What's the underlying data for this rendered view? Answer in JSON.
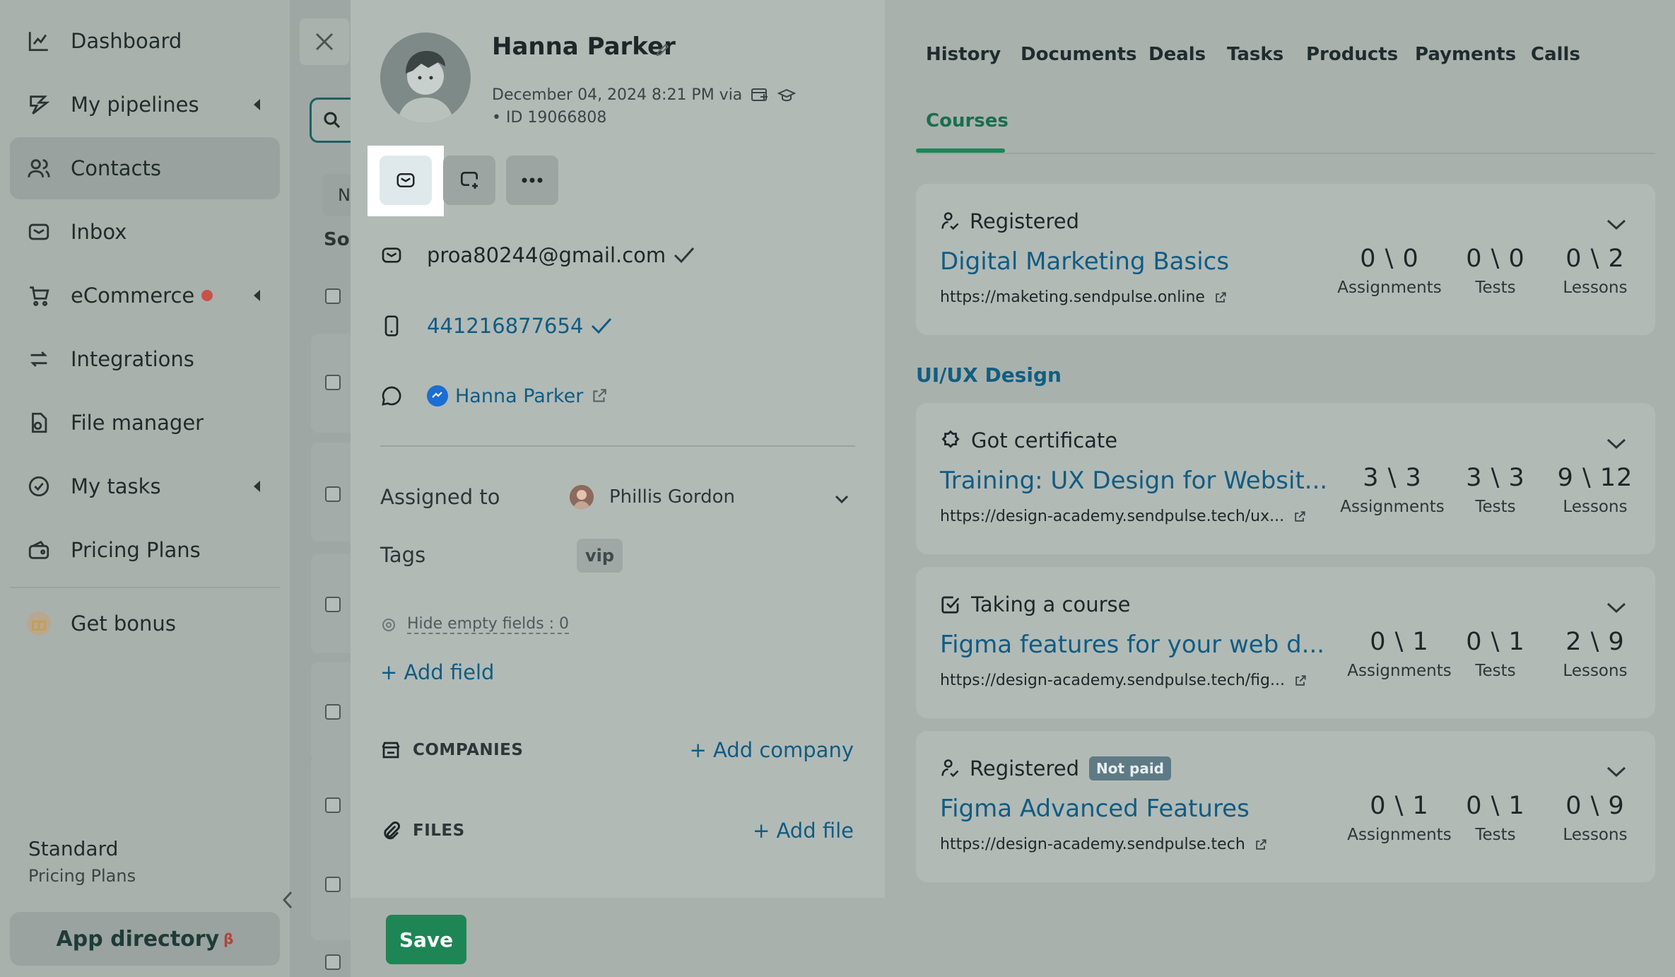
{
  "sidebar": {
    "items": [
      {
        "label": "Dashboard",
        "icon": "chart-line-icon"
      },
      {
        "label": "My pipelines",
        "icon": "pipelines-icon"
      },
      {
        "label": "Contacts",
        "icon": "contacts-icon"
      },
      {
        "label": "Inbox",
        "icon": "inbox-icon"
      },
      {
        "label": "eCommerce",
        "icon": "cart-icon"
      },
      {
        "label": "Integrations",
        "icon": "integrations-icon"
      },
      {
        "label": "File manager",
        "icon": "file-manager-icon"
      },
      {
        "label": "My tasks",
        "icon": "tasks-icon"
      },
      {
        "label": "Pricing Plans",
        "icon": "wallet-icon"
      },
      {
        "label": "Get bonus",
        "icon": "gift-icon"
      }
    ],
    "plan_name": "Standard",
    "plan_sub": "Pricing Plans",
    "app_directory": "App directory",
    "app_directory_badge": "β"
  },
  "background": {
    "tab_peek": "N",
    "sort_peek": "So"
  },
  "contact": {
    "name": "Hanna Parker",
    "created": "December 04, 2024 8:21 PM via",
    "id": "• ID 19066808",
    "email": "proa80244@gmail.com",
    "phone": "441216877654",
    "messenger_name": "Hanna Parker",
    "assigned_label": "Assigned to",
    "assignee": "Phillis Gordon",
    "tags_label": "Tags",
    "tag": "vip",
    "hide_empty": "Hide empty fields : 0",
    "add_field": "+ Add field",
    "companies_label": "COMPANIES",
    "add_company": "+ Add company",
    "files_label": "FILES",
    "add_file": "+ Add file",
    "save": "Save"
  },
  "tabs": [
    "History",
    "Documents",
    "Deals",
    "Tasks",
    "Products",
    "Payments",
    "Calls"
  ],
  "active_tab": "Courses",
  "group_title": "UI/UX Design",
  "courses": [
    {
      "status": "Registered",
      "status_icon": "user-registered-icon",
      "not_paid": "",
      "title": "Digital Marketing Basics",
      "url": "https://maketing.sendpulse.online",
      "assignments": "0 \\ 0",
      "tests": "0 \\ 0",
      "lessons": "0 \\ 2"
    },
    {
      "status": "Got certificate",
      "status_icon": "certificate-icon",
      "not_paid": "",
      "title": "Training: UX Design for Websit...",
      "url": "https://design-academy.sendpulse.tech/ux...",
      "assignments": "3 \\ 3",
      "tests": "3 \\ 3",
      "lessons": "9 \\ 12"
    },
    {
      "status": "Taking a course",
      "status_icon": "checkbox-icon",
      "not_paid": "",
      "title": "Figma features for your web d...",
      "url": "https://design-academy.sendpulse.tech/fig...",
      "assignments": "0 \\ 1",
      "tests": "0 \\ 1",
      "lessons": "2 \\ 9"
    },
    {
      "status": "Registered",
      "status_icon": "user-registered-icon",
      "not_paid": "Not paid",
      "title": "Figma Advanced Features",
      "url": "https://design-academy.sendpulse.tech",
      "assignments": "0 \\ 1",
      "tests": "0 \\ 1",
      "lessons": "0 \\ 9"
    }
  ],
  "stat_labels": {
    "assignments": "Assignments",
    "tests": "Tests",
    "lessons": "Lessons"
  },
  "colors": {
    "accent_green": "#1e8654",
    "link_blue": "#105c83",
    "badge_red": "#c6524a"
  }
}
